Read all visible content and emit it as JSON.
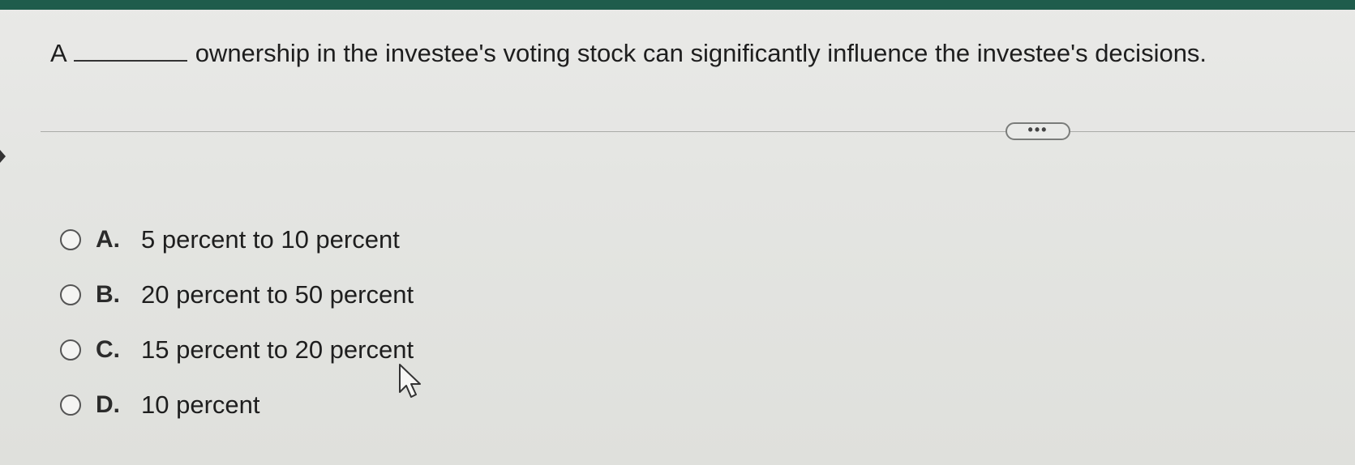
{
  "question": {
    "prefix": "A",
    "suffix": "ownership in the investee's voting stock can significantly influence the investee's decisions."
  },
  "more_button": {
    "label": "•••"
  },
  "options": [
    {
      "letter": "A.",
      "text": "5 percent to 10 percent"
    },
    {
      "letter": "B.",
      "text": "20 percent to 50 percent"
    },
    {
      "letter": "C.",
      "text": "15 percent to 20 percent"
    },
    {
      "letter": "D.",
      "text": "10 percent"
    }
  ],
  "colors": {
    "top_bar": "#1f5c4c",
    "background": "#e4e5e2",
    "text": "#1e1e1e"
  },
  "icons": {
    "cursor": "mouse-pointer-icon",
    "radio": "radio-unselected-icon"
  }
}
